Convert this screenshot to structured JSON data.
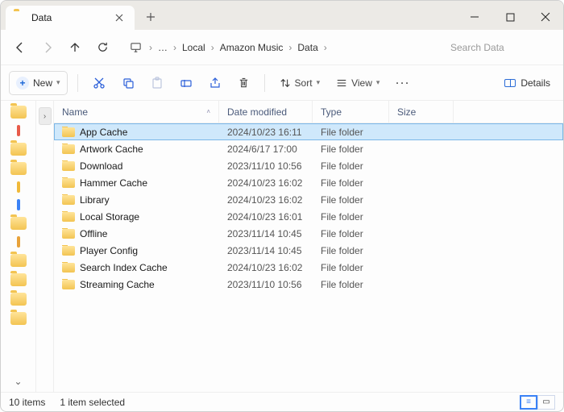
{
  "tab": {
    "title": "Data",
    "icon": "folder-icon"
  },
  "nav": {
    "back_enabled": true,
    "forward_enabled": false,
    "breadcrumb": [
      "Local",
      "Amazon Music",
      "Data"
    ]
  },
  "search": {
    "placeholder": "Search Data"
  },
  "toolbar": {
    "new_label": "New",
    "sort_label": "Sort",
    "view_label": "View",
    "details_label": "Details"
  },
  "columns": {
    "name": "Name",
    "date": "Date modified",
    "type": "Type",
    "size": "Size"
  },
  "rows": [
    {
      "name": "App Cache",
      "date": "2024/10/23 16:11",
      "type": "File folder",
      "size": "",
      "selected": true
    },
    {
      "name": "Artwork Cache",
      "date": "2024/6/17 17:00",
      "type": "File folder",
      "size": "",
      "selected": false
    },
    {
      "name": "Download",
      "date": "2023/11/10 10:56",
      "type": "File folder",
      "size": "",
      "selected": false
    },
    {
      "name": "Hammer Cache",
      "date": "2024/10/23 16:02",
      "type": "File folder",
      "size": "",
      "selected": false
    },
    {
      "name": "Library",
      "date": "2024/10/23 16:02",
      "type": "File folder",
      "size": "",
      "selected": false
    },
    {
      "name": "Local Storage",
      "date": "2024/10/23 16:01",
      "type": "File folder",
      "size": "",
      "selected": false
    },
    {
      "name": "Offline",
      "date": "2023/11/14 10:45",
      "type": "File folder",
      "size": "",
      "selected": false
    },
    {
      "name": "Player Config",
      "date": "2023/11/14 10:45",
      "type": "File folder",
      "size": "",
      "selected": false
    },
    {
      "name": "Search Index Cache",
      "date": "2024/10/23 16:02",
      "type": "File folder",
      "size": "",
      "selected": false
    },
    {
      "name": "Streaming Cache",
      "date": "2023/11/10 10:56",
      "type": "File folder",
      "size": "",
      "selected": false
    }
  ],
  "sidebar_stubs": [
    {
      "kind": "fold"
    },
    {
      "kind": "bar",
      "color": "#e85b4a"
    },
    {
      "kind": "fold"
    },
    {
      "kind": "fold"
    },
    {
      "kind": "bar",
      "color": "#f0b93a"
    },
    {
      "kind": "bar",
      "color": "#3b82f6"
    },
    {
      "kind": "fold"
    },
    {
      "kind": "bar",
      "color": "#e8a23a"
    },
    {
      "kind": "fold"
    },
    {
      "kind": "fold"
    },
    {
      "kind": "fold"
    },
    {
      "kind": "fold"
    }
  ],
  "status": {
    "count": "10 items",
    "selection": "1 item selected"
  }
}
